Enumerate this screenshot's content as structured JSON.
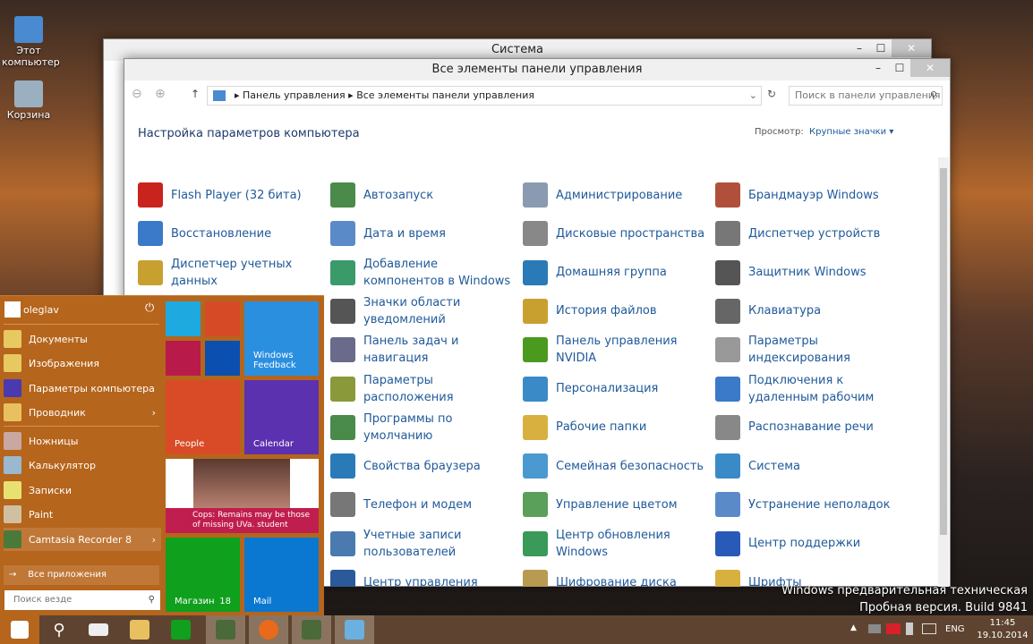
{
  "desktop": {
    "icons": [
      {
        "label": "Этот компьютер"
      },
      {
        "label": "Корзина"
      }
    ]
  },
  "back_window": {
    "title": "Система"
  },
  "window": {
    "title": "Все элементы панели управления",
    "breadcrumb": [
      "Панель управления",
      "Все элементы панели управления"
    ],
    "search_placeholder": "Поиск в панели управления",
    "heading": "Настройка параметров компьютера",
    "view_label": "Просмотр:",
    "view_value": "Крупные значки",
    "columns": [
      [
        {
          "label": "Flash Player (32 бита)",
          "color": "#c8231c"
        },
        {
          "label": "Восстановление",
          "color": "#3a7ac8"
        },
        {
          "label": "Диспетчер учетных данных",
          "color": "#c8a030"
        }
      ],
      [
        {
          "label": "Автозапуск",
          "color": "#4a8a4a"
        },
        {
          "label": "Дата и время",
          "color": "#5a8ac8"
        },
        {
          "label": "Добавление компонентов в Windows",
          "color": "#3a9a6a"
        },
        {
          "label": "Значки области уведомлений",
          "color": "#555"
        },
        {
          "label": "Панель задач и навигация",
          "color": "#6a6a8a"
        },
        {
          "label": "Параметры расположения",
          "color": "#8a9a3a"
        },
        {
          "label": "Программы по умолчанию",
          "color": "#4a8a4a"
        },
        {
          "label": "Свойства браузера",
          "color": "#2a7ab8"
        },
        {
          "label": "Телефон и модем",
          "color": "#777"
        },
        {
          "label": "Учетные записи пользователей",
          "color": "#4a7ab0"
        },
        {
          "label": "Центр управления",
          "color": "#2a5a9a"
        }
      ],
      [
        {
          "label": "Администрирование",
          "color": "#8a9ab0"
        },
        {
          "label": "Дисковые пространства",
          "color": "#888"
        },
        {
          "label": "Домашняя группа",
          "color": "#2a7ab8"
        },
        {
          "label": "История файлов",
          "color": "#c8a030"
        },
        {
          "label": "Панель управления NVIDIA",
          "color": "#4a9a20"
        },
        {
          "label": "Персонализация",
          "color": "#3a8ac8"
        },
        {
          "label": "Рабочие папки",
          "color": "#d8b040"
        },
        {
          "label": "Семейная безопасность",
          "color": "#4a9ad0"
        },
        {
          "label": "Управление цветом",
          "color": "#5aa05a"
        },
        {
          "label": "Центр обновления Windows",
          "color": "#3a9a5a"
        },
        {
          "label": "Шифрование диска",
          "color": "#b89a50"
        }
      ],
      [
        {
          "label": "Брандмауэр Windows",
          "color": "#b0503a"
        },
        {
          "label": "Диспетчер устройств",
          "color": "#777"
        },
        {
          "label": "Защитник Windows",
          "color": "#555"
        },
        {
          "label": "Клавиатура",
          "color": "#666"
        },
        {
          "label": "Параметры индексирования",
          "color": "#999"
        },
        {
          "label": "Подключения к удаленным рабочим",
          "color": "#3a7ac8"
        },
        {
          "label": "Распознавание речи",
          "color": "#888"
        },
        {
          "label": "Система",
          "color": "#3a8ac8"
        },
        {
          "label": "Устранение неполадок",
          "color": "#5a8ac8"
        },
        {
          "label": "Центр поддержки",
          "color": "#2a5ab8"
        },
        {
          "label": "Шрифты",
          "color": "#d8b040"
        }
      ]
    ]
  },
  "start": {
    "user": "oleglav",
    "items": [
      {
        "label": "Документы",
        "color": "#e8c860"
      },
      {
        "label": "Изображения",
        "color": "#e8c860"
      },
      {
        "label": "Параметры компьютера",
        "color": "#4a3ab0"
      },
      {
        "label": "Проводник",
        "color": "#e8c060",
        "arrow": "›"
      },
      {
        "label": "Ножницы",
        "color": "#c8a8a0"
      },
      {
        "label": "Калькулятор",
        "color": "#9ab8d0"
      },
      {
        "label": "Записки",
        "color": "#e8e070"
      },
      {
        "label": "Paint",
        "color": "#d0c0a0"
      },
      {
        "label": "Camtasia Recorder 8",
        "color": "#4a7a3a",
        "arrow": "›"
      }
    ],
    "all_apps": "Все приложения",
    "search_placeholder": "Поиск везде",
    "tiles": {
      "feedback": "Windows Feedback",
      "people": "People",
      "calendar": "Calendar",
      "news": "Cops: Remains may be those of missing UVa. student",
      "store": "Магазин",
      "store_badge": "18",
      "mail": "Mail"
    }
  },
  "watermark": {
    "line1": "Windows предварительная техническая",
    "line2": "Пробная версия. Build 9841"
  },
  "tray": {
    "lang": "ENG",
    "time": "11:45",
    "date": "19.10.2014"
  }
}
